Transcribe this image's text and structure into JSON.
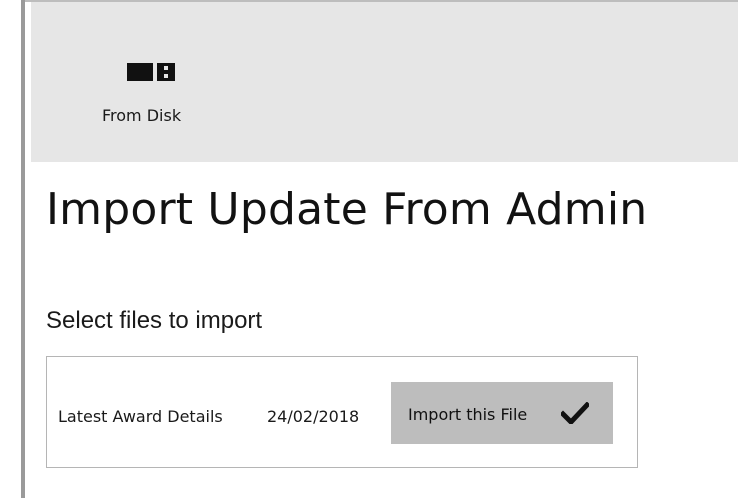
{
  "ribbon": {
    "from_disk": {
      "label": "From Disk",
      "icon": "disk-icon"
    }
  },
  "page": {
    "title": "Import Update From Admin"
  },
  "import_section": {
    "label": "Select files to import",
    "files": [
      {
        "name": "Latest Award Details",
        "date": "24/02/2018",
        "button_label": "Import this File",
        "button_icon": "check-icon"
      }
    ]
  },
  "colors": {
    "ribbon_bg": "#e6e6e6",
    "button_bg": "#bdbdbd",
    "border": "#b5b5b5"
  }
}
